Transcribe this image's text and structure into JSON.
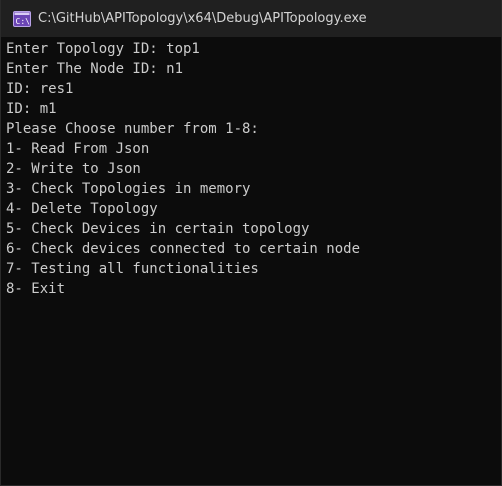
{
  "window": {
    "title": "C:\\GitHub\\APITopology\\x64\\Debug\\APITopology.exe",
    "icon": "console-app-icon"
  },
  "console": {
    "lines": [
      "Enter Topology ID: top1",
      "Enter The Node ID: n1",
      "ID: res1",
      "ID: m1",
      "Please Choose number from 1-8:",
      "1- Read From Json",
      "2- Write to Json",
      "3- Check Topologies in memory",
      "4- Delete Topology",
      "5- Check Devices in certain topology",
      "6- Check devices connected to certain node",
      "7- Testing all functionalities",
      "8- Exit"
    ]
  },
  "colors": {
    "background": "#0c0c0c",
    "titlebar": "#202020",
    "text": "#cccccc",
    "icon_accent": "#8a5cd6"
  }
}
